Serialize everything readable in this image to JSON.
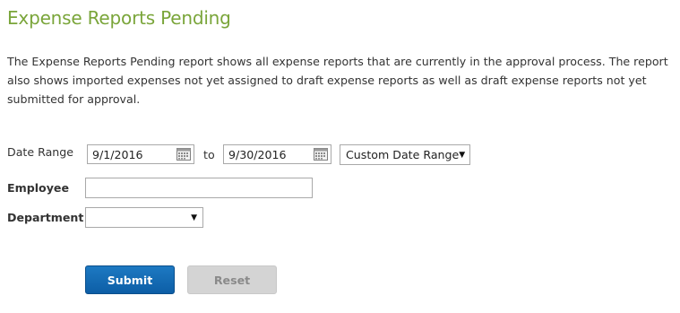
{
  "page": {
    "title": "Expense Reports Pending",
    "description": "The Expense Reports Pending report shows all expense reports that are currently in the approval process. The report also shows imported expenses not yet assigned to draft expense reports as well as draft expense reports not yet submitted for approval."
  },
  "form": {
    "date_range_label": "Date Range",
    "start_date": "9/1/2016",
    "to_label": "to",
    "end_date": "9/30/2016",
    "range_option": "Custom Date Range",
    "employee_label": "Employee",
    "employee_value": "",
    "department_label": "Department",
    "department_value": ""
  },
  "buttons": {
    "submit_label": "Submit",
    "reset_label": "Reset"
  },
  "icons": {
    "calendar": "calendar-icon",
    "dropdown": "chevron-down-icon"
  }
}
